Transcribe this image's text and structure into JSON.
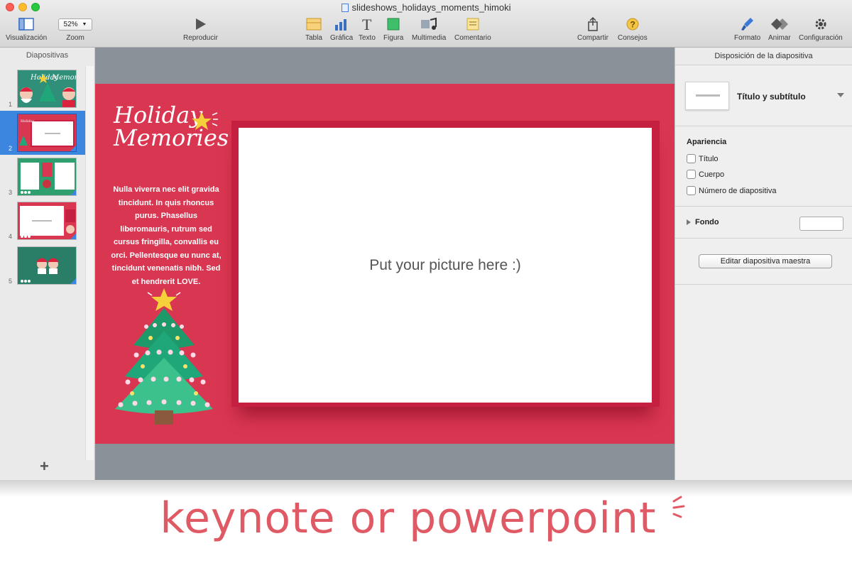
{
  "window": {
    "title": "slideshows_holidays_moments_himoki"
  },
  "toolbar": {
    "view_label": "Visualización",
    "zoom_value": "52%",
    "zoom_label": "Zoom",
    "play_label": "Reproducir",
    "table_label": "Tabla",
    "chart_label": "Gráfica",
    "text_label": "Texto",
    "shape_label": "Figura",
    "media_label": "Multimedia",
    "comment_label": "Comentario",
    "share_label": "Compartir",
    "tips_label": "Consejos",
    "format_label": "Formato",
    "animate_label": "Animar",
    "setup_label": "Configuración"
  },
  "sidebar": {
    "title": "Diapositivas",
    "slides": [
      {
        "number": "1"
      },
      {
        "number": "2",
        "selected": true
      },
      {
        "number": "3"
      },
      {
        "number": "4"
      },
      {
        "number": "5"
      }
    ],
    "add_symbol": "+"
  },
  "slide": {
    "title_line1": "Holiday",
    "title_line2": "Memories",
    "body": "Nulla viverra nec elit gravida tincidunt. In quis rhoncus purus. Phasellus liberomauris, rutrum sed cursus fringilla, convallis eu orci. Pellentesque eu nunc at, tincidunt venenatis nibh. Sed et hendrerit LOVE.",
    "placeholder": "Put your picture here :)"
  },
  "inspector": {
    "header": "Disposición de la diapositiva",
    "layout_name": "Título y subtítulo",
    "appearance_title": "Apariencia",
    "checkbox_title": "Título",
    "checkbox_body": "Cuerpo",
    "checkbox_slide_number": "Número de diapositiva",
    "background_label": "Fondo",
    "edit_master_button": "Editar diapositiva maestra"
  },
  "caption": "keynote or powerpoint",
  "colors": {
    "slide_bg": "#d93651",
    "frame": "#c52040",
    "selection": "#3c86e0",
    "caption": "#e05a66"
  }
}
